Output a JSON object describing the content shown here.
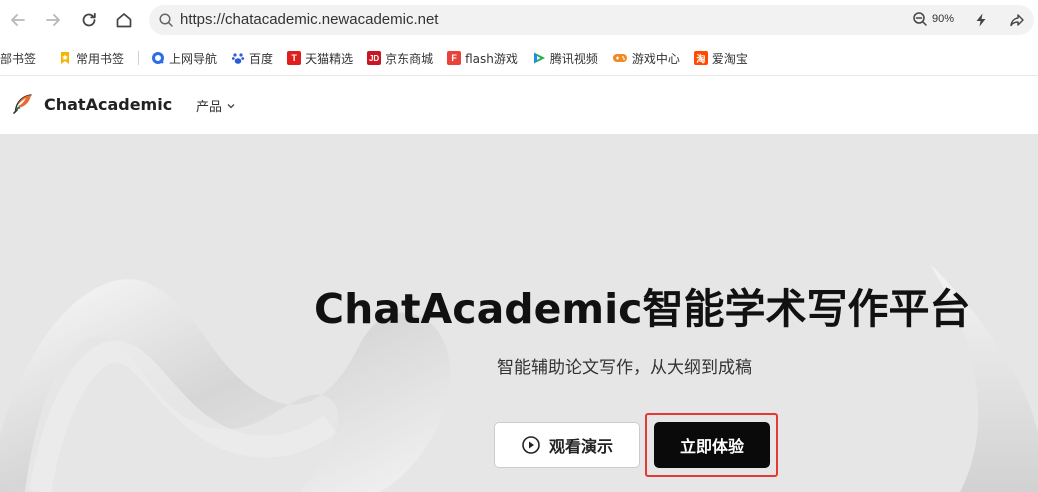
{
  "browser": {
    "url": "https://chatacademic.newacademic.net",
    "zoom": "90%"
  },
  "bookmarks": [
    {
      "label": "部书签",
      "icon": "none",
      "color": ""
    },
    {
      "label": "常用书签",
      "icon": "bookmark-star-icon",
      "color": "#f5b400"
    },
    {
      "label": "上网导航",
      "icon": "navigation-icon",
      "color": "#2b6de8"
    },
    {
      "label": "百度",
      "icon": "baidu-paw-icon",
      "color": "#2e59d9"
    },
    {
      "label": "天猫精选",
      "icon": "tmall-icon",
      "color": "#e01e1e",
      "glyph": "T"
    },
    {
      "label": "京东商城",
      "icon": "jd-icon",
      "color": "#c91623",
      "glyph": "JD"
    },
    {
      "label": "flash游戏",
      "icon": "flash-game-icon",
      "color": "#e8433a",
      "glyph": "F"
    },
    {
      "label": "腾讯视频",
      "icon": "tencent-video-icon",
      "color": "#20b14a"
    },
    {
      "label": "游戏中心",
      "icon": "game-center-icon",
      "color": "#f08a24"
    },
    {
      "label": "爱淘宝",
      "icon": "taobao-icon",
      "color": "#ff4a00",
      "glyph": "淘"
    }
  ],
  "site": {
    "brand": "ChatAcademic",
    "nav_products": "产品"
  },
  "hero": {
    "title": "ChatAcademic智能学术写作平台",
    "subtitle": "智能辅助论文写作，从大纲到成稿",
    "demo_button": "观看演示",
    "start_button": "立即体验"
  }
}
